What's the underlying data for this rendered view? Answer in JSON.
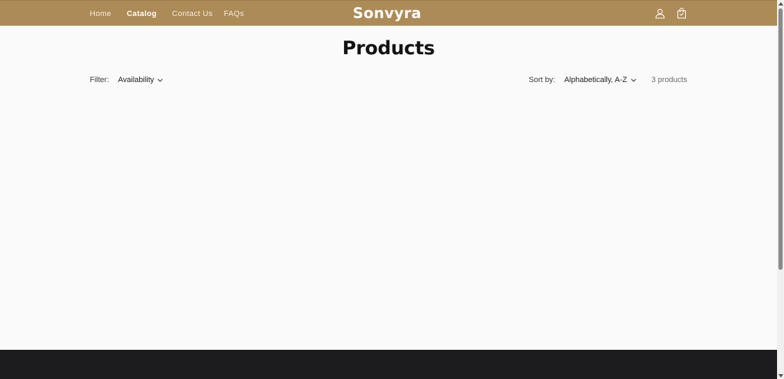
{
  "header": {
    "nav": [
      {
        "label": "Home",
        "active": false
      },
      {
        "label": "Catalog",
        "active": true
      },
      {
        "label": "Contact Us",
        "active": false
      },
      {
        "label": "FAQs",
        "active": false
      }
    ],
    "brand": "Sonvyra",
    "icons": [
      "account-icon",
      "cart-icon"
    ],
    "background_color": "#ad8b56"
  },
  "main": {
    "title": "Products",
    "filter": {
      "label": "Filter:",
      "availability_label": "Availability"
    },
    "sort": {
      "label": "Sort by:",
      "selected": "Alphabetically, A-Z"
    },
    "product_count": "3 products"
  },
  "footer": {
    "background_color": "#1c1c1e"
  }
}
